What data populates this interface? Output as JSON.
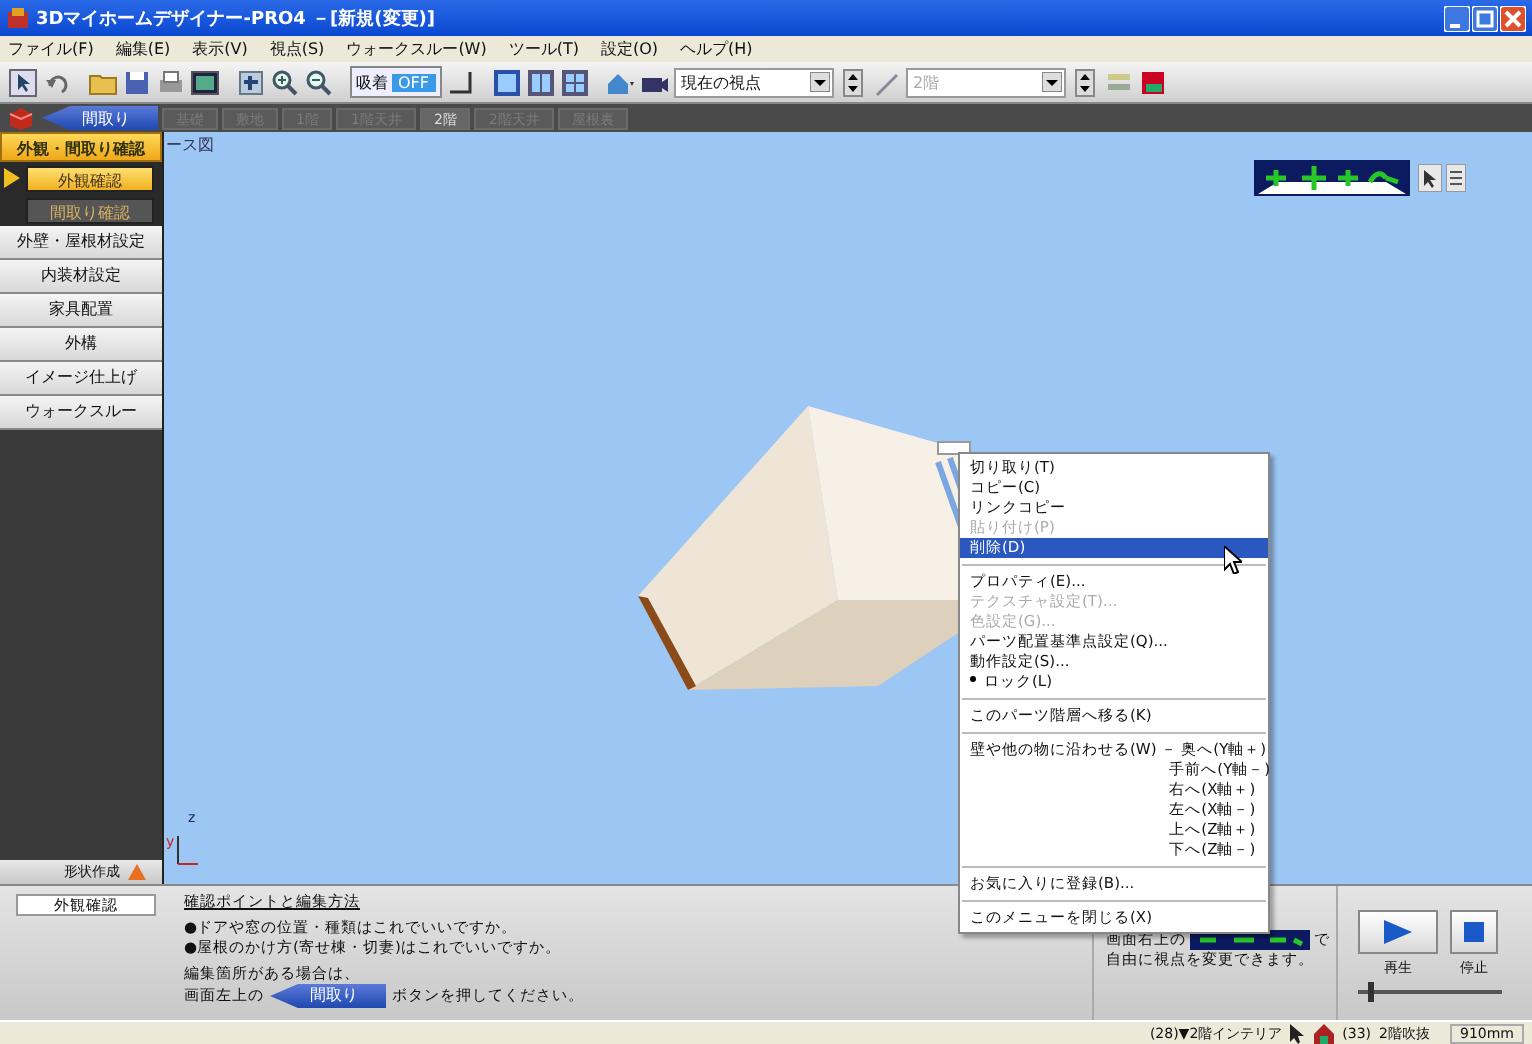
{
  "window": {
    "title": "3Dマイホームデザイナー-PRO4 －[新規(変更)]"
  },
  "menu_bar": [
    "ファイル(F)",
    "編集(E)",
    "表示(V)",
    "視点(S)",
    "ウォークスルー(W)",
    "ツール(T)",
    "設定(O)",
    "ヘルプ(H)"
  ],
  "toolbar": {
    "snap_label": "吸着",
    "snap_state": "OFF",
    "viewpoint_dropdown": "現在の視点",
    "floor_dropdown": "2階"
  },
  "floor_tabs": {
    "back_button": "間取り",
    "tabs": [
      {
        "label": "基礎",
        "disabled": true
      },
      {
        "label": "敷地",
        "disabled": true
      },
      {
        "label": "1階",
        "disabled": true
      },
      {
        "label": "1階天井",
        "disabled": true
      },
      {
        "label": "2階",
        "disabled": false
      },
      {
        "label": "2階天井",
        "disabled": true
      },
      {
        "label": "屋根裏",
        "disabled": true
      }
    ]
  },
  "sidebar": {
    "items": [
      {
        "kind": "header",
        "label": "外観・間取り確認"
      },
      {
        "kind": "sub",
        "label": "外観確認",
        "selected": true
      },
      {
        "kind": "sub",
        "label": "間取り確認",
        "selected": false
      },
      {
        "kind": "item",
        "label": "外壁・屋根材設定"
      },
      {
        "kind": "item",
        "label": "内装材設定"
      },
      {
        "kind": "item",
        "label": "家具配置"
      },
      {
        "kind": "item",
        "label": "外構"
      },
      {
        "kind": "item",
        "label": "イメージ仕上げ"
      },
      {
        "kind": "item",
        "label": "ウォークスルー"
      }
    ],
    "footer": "形状作成"
  },
  "viewport": {
    "view_label": "ース図",
    "axis_labels": [
      "z",
      "y"
    ]
  },
  "context_menu": [
    {
      "kind": "item",
      "label": "切り取り(T)",
      "disabled": false,
      "selected": false
    },
    {
      "kind": "item",
      "label": "コピー(C)",
      "disabled": false,
      "selected": false
    },
    {
      "kind": "item",
      "label": "リンクコピー",
      "disabled": false,
      "selected": false
    },
    {
      "kind": "item",
      "label": "貼り付け(P)",
      "disabled": true,
      "selected": false
    },
    {
      "kind": "item",
      "label": "削除(D)",
      "disabled": false,
      "selected": true
    },
    {
      "kind": "separator"
    },
    {
      "kind": "item",
      "label": "プロパティ(E)...",
      "disabled": false,
      "selected": false
    },
    {
      "kind": "item",
      "label": "テクスチャ設定(T)...",
      "disabled": true,
      "selected": false
    },
    {
      "kind": "item",
      "label": "色設定(G)...",
      "disabled": true,
      "selected": false
    },
    {
      "kind": "item",
      "label": "パーツ配置基準点設定(Q)...",
      "disabled": false,
      "selected": false
    },
    {
      "kind": "item",
      "label": "動作設定(S)...",
      "disabled": false,
      "selected": false
    },
    {
      "kind": "check",
      "label": "ロック(L)",
      "checked": true,
      "disabled": false,
      "selected": false
    },
    {
      "kind": "separator"
    },
    {
      "kind": "item",
      "label": "このパーツ階層へ移る(K)",
      "disabled": false,
      "selected": false
    },
    {
      "kind": "separator"
    },
    {
      "kind": "submenu",
      "label": "壁や他の物に沿わせる(W) －",
      "options": [
        "奥へ(Y軸＋)",
        "手前へ(Y軸－)",
        "右へ(X軸＋)",
        "左へ(X軸－)",
        "上へ(Z軸＋)",
        "下へ(Z軸－)"
      ]
    },
    {
      "kind": "separator"
    },
    {
      "kind": "item",
      "label": "お気に入りに登録(B)...",
      "disabled": false,
      "selected": false
    },
    {
      "kind": "separator"
    },
    {
      "kind": "item",
      "label": "このメニューを閉じる(X)",
      "disabled": false,
      "selected": false
    }
  ],
  "bottom_panel": {
    "mode_field": "外観確認",
    "heading": "確認ポイントと編集方法",
    "lines": [
      "●ドアや窓の位置・種類はこれでいいですか。",
      "●屋根のかけ方(寄せ棟・切妻)はこれでいいですか。"
    ],
    "edit_note": "編集箇所がある場合は、",
    "edit_prefix": "画面左上の",
    "edit_button": "間取り",
    "edit_suffix": "ボタンを押してください。",
    "view_hint_prefix": "画面右上の",
    "view_hint_suffix": "で",
    "view_hint_line2": "自由に視点を変更できます。",
    "play_label": "再生",
    "stop_label": "停止",
    "speed": {
      "level": 0.08
    }
  },
  "status_bar": [
    "(28)▼2階インテリア",
    "(33)",
    "2階吹抜",
    "910mm"
  ]
}
